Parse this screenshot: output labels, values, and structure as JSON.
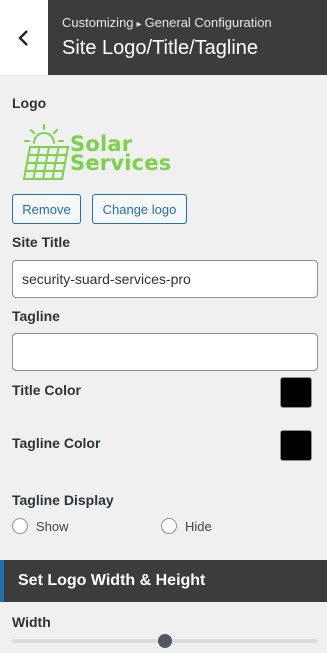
{
  "header": {
    "breadcrumb_root": "Customizing",
    "breadcrumb_separator": "▸",
    "breadcrumb_section": "General Configuration",
    "title": "Site Logo/Title/Tagline",
    "back_icon": "chevron-left-icon"
  },
  "logo": {
    "label": "Logo",
    "brand_line1": "Solar",
    "brand_line2": "Services",
    "brand_color": "#7bd34b",
    "remove_label": "Remove",
    "change_label": "Change logo"
  },
  "site_title": {
    "label": "Site Title",
    "value": "security-suard-services-pro"
  },
  "tagline": {
    "label": "Tagline",
    "value": ""
  },
  "title_color": {
    "label": "Title Color",
    "value": "#000000"
  },
  "tagline_color": {
    "label": "Tagline Color",
    "value": "#000000"
  },
  "tagline_display": {
    "label": "Tagline Display",
    "options": [
      "Show",
      "Hide"
    ]
  },
  "section": {
    "title": "Set Logo Width & Height"
  },
  "width": {
    "label": "Width",
    "slider_fraction": 0.5
  },
  "colors": {
    "accent": "#2271b1",
    "header_bg": "#3c3c3c"
  }
}
